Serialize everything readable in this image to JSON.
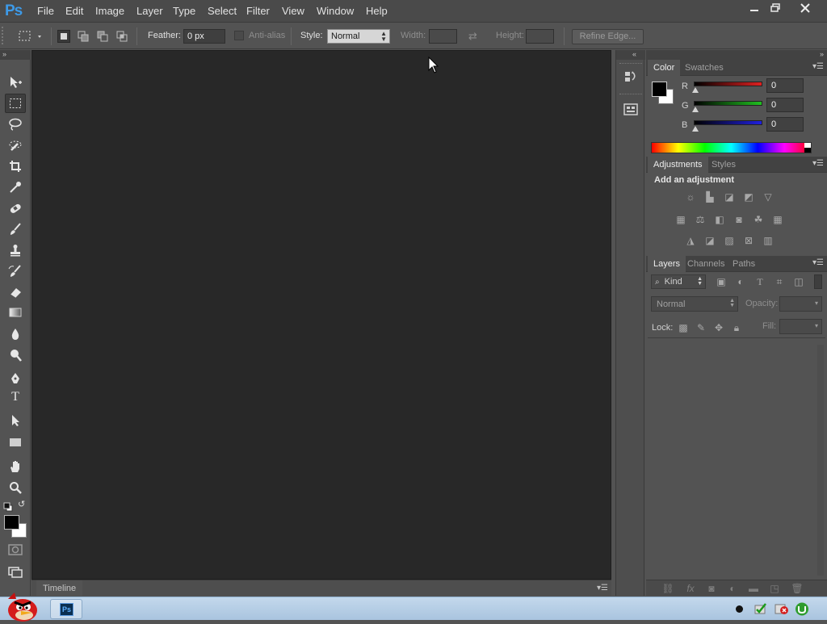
{
  "app": {
    "logo": "Ps"
  },
  "menubar": {
    "items": [
      "File",
      "Edit",
      "Image",
      "Layer",
      "Type",
      "Select",
      "Filter",
      "View",
      "Window",
      "Help"
    ],
    "window_controls": [
      "minimize-icon",
      "restore-icon",
      "close-icon"
    ]
  },
  "options_bar": {
    "feather_label": "Feather:",
    "feather_value": "0 px",
    "antialias_label": "Anti-alias",
    "style_label": "Style:",
    "style_value": "Normal",
    "width_label": "Width:",
    "height_label": "Height:",
    "refine_edge_label": "Refine Edge..."
  },
  "toolbox": {
    "tools": [
      "move-tool",
      "rectangular-marquee-tool",
      "lasso-tool",
      "quick-selection-tool",
      "crop-tool",
      "eyedropper-tool",
      "spot-healing-brush-tool",
      "brush-tool",
      "clone-stamp-tool",
      "history-brush-tool",
      "eraser-tool",
      "gradient-tool",
      "blur-tool",
      "dodge-tool",
      "pen-tool",
      "type-tool",
      "path-selection-tool",
      "rectangle-tool",
      "hand-tool",
      "zoom-tool"
    ],
    "type_tool_glyph": "T",
    "foreground_color": "#000000",
    "background_color": "#ffffff"
  },
  "timeline": {
    "label": "Timeline"
  },
  "color_panel": {
    "tabs": [
      "Color",
      "Swatches"
    ],
    "channels": [
      {
        "label": "R",
        "value": "0",
        "color": "#e02020"
      },
      {
        "label": "G",
        "value": "0",
        "color": "#20c020"
      },
      {
        "label": "B",
        "value": "0",
        "color": "#2020e0"
      }
    ]
  },
  "adjustments_panel": {
    "tabs": [
      "Adjustments",
      "Styles"
    ],
    "heading": "Add an adjustment"
  },
  "layers_panel": {
    "tabs": [
      "Layers",
      "Channels",
      "Paths"
    ],
    "filter_label": "Kind",
    "blend_mode": "Normal",
    "opacity_label": "Opacity:",
    "lock_label": "Lock:",
    "fill_label": "Fill:"
  },
  "colors": {
    "accent": "#3d9ae8",
    "canvas_bg": "#282828",
    "panel_bg": "#535353"
  }
}
